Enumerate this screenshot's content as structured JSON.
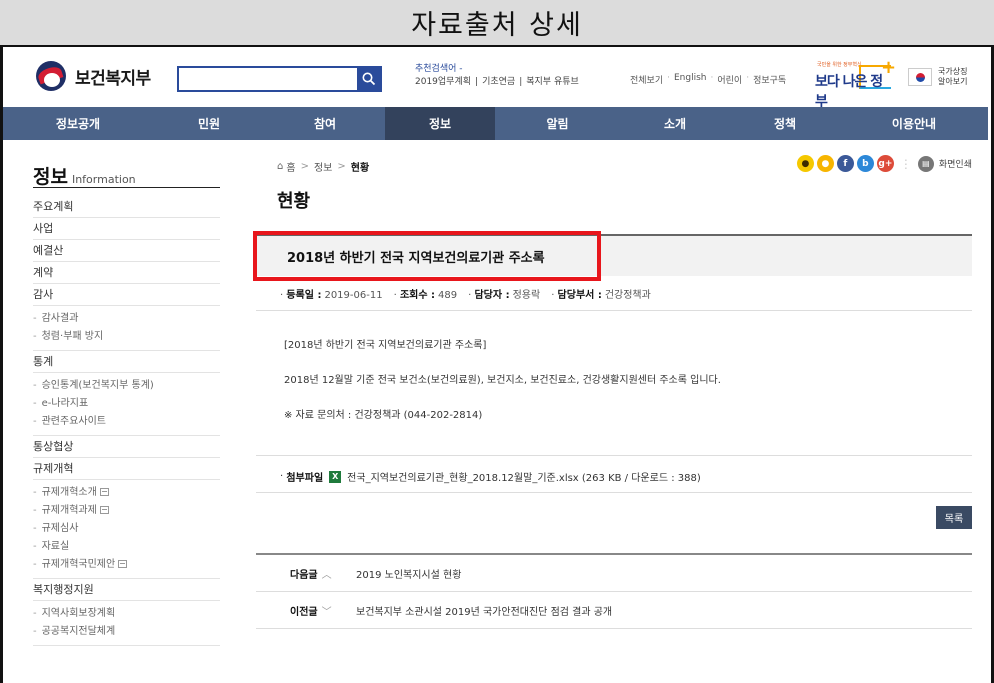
{
  "caption": "자료출처 상세",
  "header": {
    "logo_text": "보건복지부",
    "search": {
      "placeholder": "",
      "value": ""
    },
    "recommend": {
      "title": "추천검색어 -",
      "links": [
        "2019업무계획",
        "기초연금",
        "복지부 유튜브"
      ]
    },
    "util_links": [
      "전체보기",
      "English",
      "어린이",
      "정보구독"
    ],
    "better_gov": {
      "small": "국민을 위한 정부혁신",
      "main": "보다 나은 정부"
    },
    "national_symbol": [
      "국가상징",
      "알아보기"
    ]
  },
  "nav": {
    "items": [
      {
        "label": "정보공개",
        "active": false
      },
      {
        "label": "민원",
        "active": false
      },
      {
        "label": "참여",
        "active": false
      },
      {
        "label": "정보",
        "active": true
      },
      {
        "label": "알림",
        "active": false
      },
      {
        "label": "소개",
        "active": false
      },
      {
        "label": "정책",
        "active": false
      },
      {
        "label": "이용안내",
        "active": false
      }
    ]
  },
  "sidebar": {
    "title": "정보",
    "subtitle": "Information",
    "items": [
      {
        "label": "주요계획"
      },
      {
        "label": "사업"
      },
      {
        "label": "예결산"
      },
      {
        "label": "계약"
      },
      {
        "label": "감사",
        "subs": [
          {
            "label": "감사결과"
          },
          {
            "label": "청렴·부패 방지"
          }
        ]
      },
      {
        "label": "통계",
        "subs": [
          {
            "label": "승인통계(보건복지부 통계)"
          },
          {
            "label": "e-나라지표"
          },
          {
            "label": "관련주요사이트"
          }
        ]
      },
      {
        "label": "통상협상"
      },
      {
        "label": "규제개혁",
        "subs": [
          {
            "label": "규제개혁소개",
            "ext": true
          },
          {
            "label": "규제개혁과제",
            "ext": true
          },
          {
            "label": "규제심사"
          },
          {
            "label": "자료실"
          },
          {
            "label": "규제개혁국민제안",
            "ext": true
          }
        ]
      },
      {
        "label": "복지행정지원",
        "subs": [
          {
            "label": "지역사회보장계획"
          },
          {
            "label": "공공복지전달체계"
          }
        ]
      }
    ]
  },
  "main": {
    "breadcrumb": {
      "home": "홈",
      "section": "정보",
      "current": "현황"
    },
    "share": [
      "카카오스토리",
      "카카오톡",
      "페이스북",
      "블로그",
      "구글플러스"
    ],
    "print_label": "화면인쇄",
    "page_title": "현황",
    "post": {
      "title": "2018년 하반기 전국 지역보건의료기관 주소록",
      "meta": {
        "date_label": "등록일 :",
        "date": "2019-06-11",
        "views_label": "조회수 :",
        "views": "489",
        "manager_label": "담당자 :",
        "manager": "정용락",
        "dept_label": "담당부서 :",
        "dept": "건강정책과"
      },
      "body": [
        "[2018년 하반기 전국 지역보건의료기관 주소록]",
        "2018년 12월말 기준 전국 보건소(보건의료원), 보건지소, 보건진료소, 건강생활지원센터 주소록 입니다.",
        "※ 자료 문의처 : 건강정책과 (044-202-2814)"
      ],
      "attach_label": "첨부파일",
      "attachment": "전국_지역보건의료기관_현황_2018.12월말_기준.xlsx (263 KB / 다운로드 : 388)"
    },
    "list_button": "목록",
    "next": {
      "label": "다음글",
      "arrow": "︿",
      "title": "2019 노인복지시설 현황"
    },
    "prev": {
      "label": "이전글",
      "arrow": "﹀",
      "title": "보건복지부 소관시설 2019년 국가안전대진단 점검 결과 공개"
    }
  }
}
